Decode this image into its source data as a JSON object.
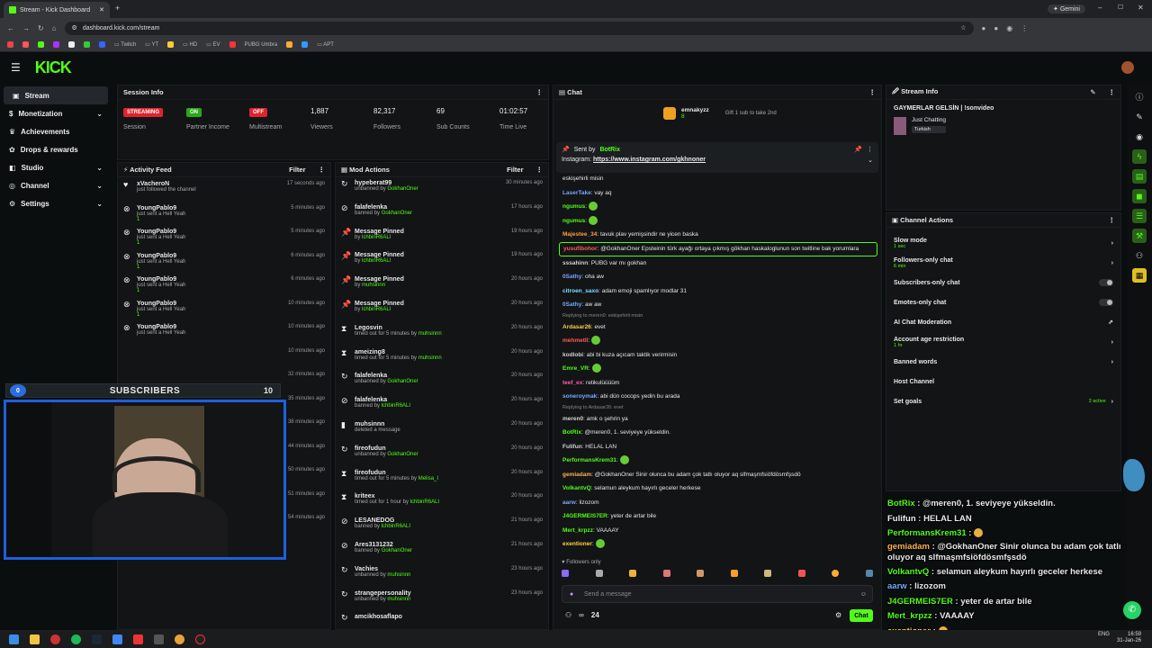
{
  "browser": {
    "tab_title": "Stream - Kick Dashboard",
    "url": "dashboard.kick.com/stream",
    "gemini": "Gemini",
    "bookmarks": [
      "Twitch",
      "YT",
      "HD",
      "EV",
      "PUBG Umbra",
      "APT"
    ]
  },
  "kick": {
    "logo": "KICK"
  },
  "nav": [
    {
      "label": "Stream",
      "icon": "stream-icon",
      "active": true
    },
    {
      "label": "Monetization",
      "icon": "money-icon",
      "chevron": true
    },
    {
      "label": "Achievements",
      "icon": "trophy-icon"
    },
    {
      "label": "Drops & rewards",
      "icon": "gift-icon"
    },
    {
      "label": "Studio",
      "icon": "studio-icon",
      "chevron": true
    },
    {
      "label": "Channel",
      "icon": "channel-icon",
      "chevron": true
    },
    {
      "label": "Settings",
      "icon": "gear-icon",
      "chevron": true
    }
  ],
  "session": {
    "title": "Session Info",
    "streaming_badge": "STREAMING",
    "session_label": "Session",
    "on_badge": "ON",
    "partner_label": "Partner Income",
    "off_badge": "OFF",
    "multistream_label": "Multistream",
    "viewers": "1,887",
    "viewers_label": "Viewers",
    "followers": "82,317",
    "followers_label": "Followers",
    "subs": "69",
    "subs_label": "Sub Counts",
    "time": "01:02:57",
    "time_label": "Time Live"
  },
  "activity": {
    "title": "Activity Feed",
    "filter": "Filter",
    "rows": [
      {
        "name": "xVacheroN",
        "sub": "just followed the channel",
        "time": "17 seconds ago",
        "gift": ""
      },
      {
        "name": "YoungPablo9",
        "sub": "just sent a Hell Yeah",
        "time": "5 minutes ago",
        "gift": "1"
      },
      {
        "name": "YoungPablo9",
        "sub": "just sent a Hell Yeah",
        "time": "5 minutes ago",
        "gift": "1"
      },
      {
        "name": "YoungPablo9",
        "sub": "just sent a Hell Yeah",
        "time": "6 minutes ago",
        "gift": "1"
      },
      {
        "name": "YoungPablo9",
        "sub": "just sent a Hell Yeah",
        "time": "6 minutes ago",
        "gift": "1"
      },
      {
        "name": "YoungPablo9",
        "sub": "just sent a Hell Yeah",
        "time": "10 minutes ago",
        "gift": "1"
      },
      {
        "name": "YoungPablo9",
        "sub": "just sent a Hell Yeah",
        "time": "10 minutes ago",
        "gift": ""
      }
    ],
    "bottom_rows": [
      {
        "name": "",
        "sub": "just followed the channel",
        "time": "50 minutes ago"
      },
      {
        "name": "N_nerdesinpango",
        "sub": "just followed the channel",
        "time": "51 minutes ago"
      },
      {
        "name": "Levian06",
        "sub": "just followed the channel",
        "time": "54 minutes ago"
      }
    ],
    "partial_times": [
      "10 minutes ago",
      "32 minutes ago",
      "35 minutes ago",
      "38 minutes ago",
      "44 minutes ago"
    ]
  },
  "mod": {
    "title": "Mod Actions",
    "filter": "Filter",
    "rows": [
      {
        "name": "hypeberat99",
        "sub": "unbanned by",
        "by": "GokhanOner",
        "time": "30 minutes ago",
        "icon": "unban-icon"
      },
      {
        "name": "falafelenka",
        "sub": "banned by",
        "by": "GokhanOner",
        "time": "17 hours ago",
        "icon": "ban-icon"
      },
      {
        "name": "Message Pinned",
        "sub": "by",
        "by": "lchbinR6ALI",
        "time": "19 hours ago",
        "icon": "pin-icon"
      },
      {
        "name": "Message Pinned",
        "sub": "by",
        "by": "lchbinR6ALI",
        "time": "19 hours ago",
        "icon": "pin-icon"
      },
      {
        "name": "Message Pinned",
        "sub": "by",
        "by": "muhsinnn",
        "time": "20 hours ago",
        "icon": "pin-icon"
      },
      {
        "name": "Message Pinned",
        "sub": "by",
        "by": "lchbinR6ALI",
        "time": "20 hours ago",
        "icon": "pin-icon"
      },
      {
        "name": "Legosvin",
        "sub": "timed out for 5 minutes by",
        "by": "muhsinnn",
        "time": "20 hours ago",
        "icon": "hourglass-icon"
      },
      {
        "name": "ameizing8",
        "sub": "timed out for 5 minutes by",
        "by": "muhsinnn",
        "time": "20 hours ago",
        "icon": "hourglass-icon"
      },
      {
        "name": "falafelenka",
        "sub": "unbanned by",
        "by": "GokhanOner",
        "time": "20 hours ago",
        "icon": "unban-icon"
      },
      {
        "name": "falafelenka",
        "sub": "banned by",
        "by": "lchbinR6ALI",
        "time": "20 hours ago",
        "icon": "ban-icon"
      },
      {
        "name": "muhsinnn",
        "sub": "deleted a message",
        "by": "",
        "time": "20 hours ago",
        "icon": "delete-icon"
      },
      {
        "name": "fireofudun",
        "sub": "unbanned by",
        "by": "GokhanOner",
        "time": "20 hours ago",
        "icon": "unban-icon"
      },
      {
        "name": "fireofudun",
        "sub": "timed out for 5 minutes by",
        "by": "Melisa_I",
        "time": "20 hours ago",
        "icon": "hourglass-icon"
      },
      {
        "name": "kriteex",
        "sub": "timed out for 1 hour by",
        "by": "lchbinR6ALI",
        "time": "20 hours ago",
        "icon": "hourglass-icon"
      },
      {
        "name": "LESANEDOG",
        "sub": "banned by",
        "by": "lchbinR6ALI",
        "time": "21 hours ago",
        "icon": "ban-icon"
      },
      {
        "name": "Ares3131232",
        "sub": "banned by",
        "by": "GokhanOner",
        "time": "21 hours ago",
        "icon": "ban-icon"
      },
      {
        "name": "Vachies",
        "sub": "unbanned by",
        "by": "muhsinnn",
        "time": "23 hours ago",
        "icon": "unban-icon"
      },
      {
        "name": "strangepersonality",
        "sub": "unbanned by",
        "by": "muhsinnn",
        "time": "23 hours ago",
        "icon": "unban-icon"
      },
      {
        "name": "amcikhosaflapo",
        "sub": "",
        "by": "",
        "time": "",
        "icon": "unban-icon"
      }
    ]
  },
  "chat": {
    "title": "Chat",
    "gifter": "emnakyzz",
    "gifter_count": "8",
    "gift_text": "Gift 1 sub to take 2nd",
    "pinned_sent_by": "Sent by",
    "pinned_user": "BotRix",
    "pinned_text": "Instagram: ",
    "pinned_link": "https://www.instagram.com/gkhnoner",
    "messages": [
      {
        "user": "",
        "color": "#888",
        "text": "eskişehirli misin",
        "tag": "meren0: "
      },
      {
        "user": "LaserTake",
        "color": "#7aa7ff",
        "text": "vay aq"
      },
      {
        "user": "ngumus",
        "color": "#53fc18",
        "text": ""
      },
      {
        "user": "ngumus",
        "color": "#53fc18",
        "text": ""
      },
      {
        "user": "Majestee_34",
        "color": "#ff9e3d",
        "text": "tavuk plav yemişsindir ne yicen baska"
      },
      {
        "user": "yusufibohor",
        "color": "#ff5a5a",
        "text": "@GokhanOner Epsteinin türk ayağı ortaya çıkmış gökhan haskaloglunun son twitline bak yorumlara",
        "highlight": true
      },
      {
        "user": "sssahinn",
        "color": "#d3d3d3",
        "text": "PUBG var mı gokhan"
      },
      {
        "user": "0Sathy",
        "color": "#7aa7ff",
        "text": "oha aw"
      },
      {
        "user": "citroen_saxo",
        "color": "#7ae0ff",
        "text": "adam emoji spamlıyor modlar 31"
      },
      {
        "user": "0Sathy",
        "color": "#7aa7ff",
        "text": "aw aw"
      },
      {
        "user": "",
        "color": "#888",
        "text": "Replying to meren0: eskişehirli misin",
        "reply": true
      },
      {
        "user": "Ardasar26",
        "color": "#ffd23d",
        "text": "evet"
      },
      {
        "user": "mehmetll",
        "color": "#ff5a5a",
        "text": ""
      },
      {
        "user": "kodlobi",
        "color": "#d3d3d3",
        "text": "abi bi kuza açıcam taktik verirmisin"
      },
      {
        "user": "Emre_VR",
        "color": "#53fc18",
        "text": ""
      },
      {
        "user": "teef_ex",
        "color": "#ff5ab4",
        "text": "retikulüüüüm"
      },
      {
        "user": "soneroymak",
        "color": "#7aa7ff",
        "text": "abi dün cocops yedin bu arada"
      },
      {
        "user": "",
        "color": "#888",
        "text": "Replying to Ardasar26: evet",
        "reply": true
      },
      {
        "user": "meren0",
        "color": "#d3d3d3",
        "text": "amk o şehrin ya"
      },
      {
        "user": "BotRix",
        "color": "#53fc18",
        "text": "@meren0, 1. seviyeye yükseldin."
      },
      {
        "user": "Fulifun",
        "color": "#d3d3d3",
        "text": "HELAL LAN"
      },
      {
        "user": "PerformansKrem31",
        "color": "#53fc18",
        "text": ""
      },
      {
        "user": "gemiadam",
        "color": "#ffb050",
        "text": "@GokhanOner Sinir olunca bu adam çok tatlı oluyor aq slfmaşmfsiöfdösmfşsdö"
      },
      {
        "user": "VolkantvQ",
        "color": "#53fc18",
        "text": "selamun aleykum hayırlı geceler herkese"
      },
      {
        "user": "aarw",
        "color": "#7aa7ff",
        "text": "lizozom"
      },
      {
        "user": "J4GERMEIS7ER",
        "color": "#53fc18",
        "text": "yeter de artar bile"
      },
      {
        "user": "Mert_krpzz",
        "color": "#53fc18",
        "text": "VAAAAY"
      },
      {
        "user": "exentioner",
        "color": "#ffd23d",
        "text": ""
      }
    ],
    "followers_only": "Followers only",
    "input_placeholder": "Send a message",
    "viewer_count": "24",
    "send_label": "Chat"
  },
  "streaminfo": {
    "title": "Stream Info",
    "stream_title": "GAYMERLAR GELSİN | !sonvideo",
    "category": "Just Chatting",
    "language": "Turkish"
  },
  "channel_actions": {
    "title": "Channel Actions",
    "rows": [
      {
        "label": "Slow mode",
        "sub": "1 sec",
        "ctrl": "chevron"
      },
      {
        "label": "Followers-only chat",
        "sub": "6 min",
        "ctrl": "chevron"
      },
      {
        "label": "Subscribers-only chat",
        "sub": "",
        "ctrl": "toggle"
      },
      {
        "label": "Emotes-only chat",
        "sub": "",
        "ctrl": "toggle"
      },
      {
        "label": "AI Chat Moderation",
        "sub": "",
        "ctrl": "external"
      },
      {
        "label": "Account age restriction",
        "sub": "1 hr",
        "ctrl": "chevron"
      },
      {
        "label": "Banned words",
        "sub": "",
        "ctrl": "chevron"
      },
      {
        "label": "Host Channel",
        "sub": "",
        "ctrl": ""
      },
      {
        "label": "Set goals",
        "sub": "",
        "ctrl": "chevron",
        "extra": "2 active"
      }
    ]
  },
  "overlay_chat": [
    {
      "user": "BotRix",
      "color": "#53fc18",
      "text": "@meren0, 1. seviyeye yükseldin."
    },
    {
      "user": "Fulifun",
      "color": "#eeeeee",
      "text": "HELAL LAN"
    },
    {
      "user": "PerformansKrem31",
      "color": "#53fc18",
      "text": ""
    },
    {
      "user": "gemiadam",
      "color": "#ffb050",
      "text": "@GokhanOner Sinir olunca bu adam çok tatlı oluyor aq slfmaşmfsiöfdösmfşsdö"
    },
    {
      "user": "VolkantvQ",
      "color": "#53fc18",
      "text": "selamun aleykum hayırlı geceler herkese"
    },
    {
      "user": "aarw",
      "color": "#7aa7ff",
      "text": "lizozom"
    },
    {
      "user": "J4GERMEIS7ER",
      "color": "#53fc18",
      "text": "yeter de artar bile"
    },
    {
      "user": "Mert_krpzz",
      "color": "#53fc18",
      "text": "VAAAAY"
    },
    {
      "user": "exentioner",
      "color": "#ffd23d",
      "text": ""
    }
  ],
  "webcam": {
    "sub_count": "0",
    "sub_title": "SUBSCRIBERS",
    "sub_goal": "10"
  },
  "taskbar": {
    "lang": "ENG",
    "time": "16:59",
    "date": "31-Jan-26"
  }
}
